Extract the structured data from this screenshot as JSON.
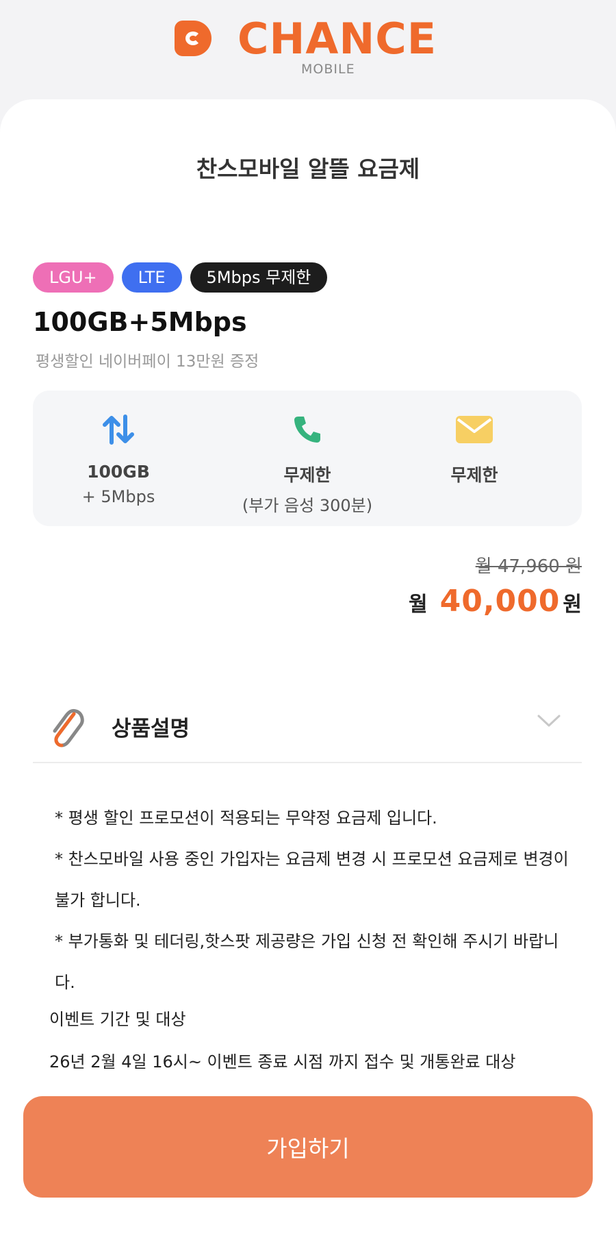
{
  "brand": {
    "name": "CHANCE",
    "sub": "MOBILE",
    "color": "#ef6a2c"
  },
  "page": {
    "title": "찬스모바일 알뜰 요금제"
  },
  "tags": [
    {
      "label": "LGU+",
      "color": "#ee6fb6"
    },
    {
      "label": "LTE",
      "color": "#3f6ff0"
    },
    {
      "label": "5Mbps 무제한",
      "color": "#1d1d1d"
    }
  ],
  "plan": {
    "name": "100GB+5Mbps",
    "description": "평생할인 네이버페이 13만원 증정"
  },
  "specs": [
    {
      "icon": "data-transfer-icon",
      "main": "100GB",
      "sub": "+ 5Mbps"
    },
    {
      "icon": "phone-icon",
      "main": "무제한",
      "sub": "(부가 음성 300분)"
    },
    {
      "icon": "mail-icon",
      "main": "무제한",
      "sub": ""
    }
  ],
  "price": {
    "original": "월 47,960 원",
    "month_label": "월",
    "value": "40,000",
    "currency": "원"
  },
  "description_section": {
    "title": "상품설명",
    "icon": "paperclip-icon",
    "notes": [
      "* 평생 할인 프로모션이 적용되는 무약정 요금제 입니다.",
      "* 찬스모바일 사용 중인 가입자는 요금제 변경 시 프로모션 요금제로 변경이 불가 합니다.",
      "* 부가통화 및 테더링,핫스팟 제공량은 가입 신청 전 확인해 주시기 바랍니다."
    ],
    "event_title": "이벤트 기간 및 대상",
    "event_text": "26년 2월 4일 16시~ 이벤트 종료 시점 까지 접수 및 개통완료 대상"
  },
  "cta": {
    "label": "가입하기",
    "color": "#ee8256"
  }
}
